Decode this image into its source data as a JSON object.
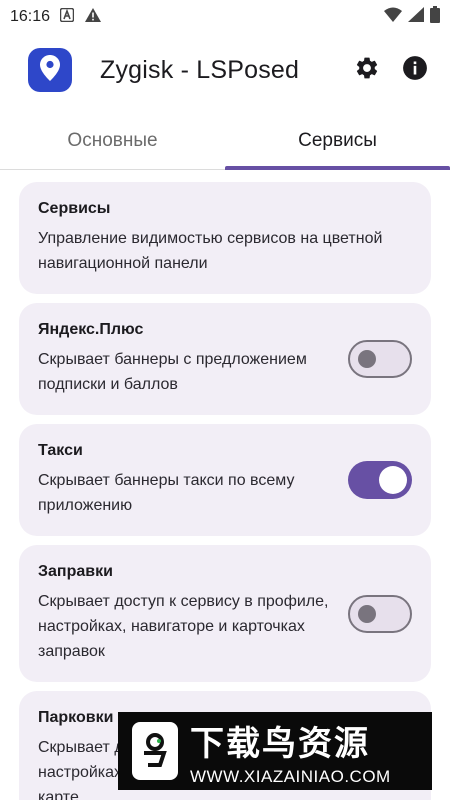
{
  "status_bar": {
    "time": "16:16",
    "icons": [
      "android-auto-icon",
      "warning-icon",
      "wifi-icon",
      "signal-icon",
      "battery-icon"
    ]
  },
  "app_bar": {
    "title": "Zygisk - LSPosed",
    "logo_icon": "location-pin-icon",
    "actions": [
      "gear-icon",
      "info-icon"
    ],
    "logo_color": "#2e47c9"
  },
  "tabs": [
    {
      "label": "Основные",
      "active": false
    },
    {
      "label": "Сервисы",
      "active": true
    }
  ],
  "accent_color": "#6750a4",
  "cards": [
    {
      "title": "Сервисы",
      "desc": "Управление видимостью сервисов на цветной навигационной панели",
      "has_switch": false
    },
    {
      "title": "Яндекс.Плюс",
      "desc": "Скрывает баннеры с предложением подписки и баллов",
      "has_switch": true,
      "enabled": false
    },
    {
      "title": "Такси",
      "desc": "Скрывает баннеры такси по всему приложению",
      "has_switch": true,
      "enabled": true
    },
    {
      "title": "Заправки",
      "desc": "Скрывает доступ к сервису в профиле, настройках, навигаторе и карточках заправок",
      "has_switch": true,
      "enabled": false
    },
    {
      "title": "Парковки",
      "desc": "Скрывает доступ к сервису в профиле, настройках и отображение парковок на карте",
      "has_switch": true,
      "enabled": false
    }
  ],
  "watermark": {
    "title": "下载鸟资源",
    "url": "WWW.XIAZAINIAO.COM"
  }
}
